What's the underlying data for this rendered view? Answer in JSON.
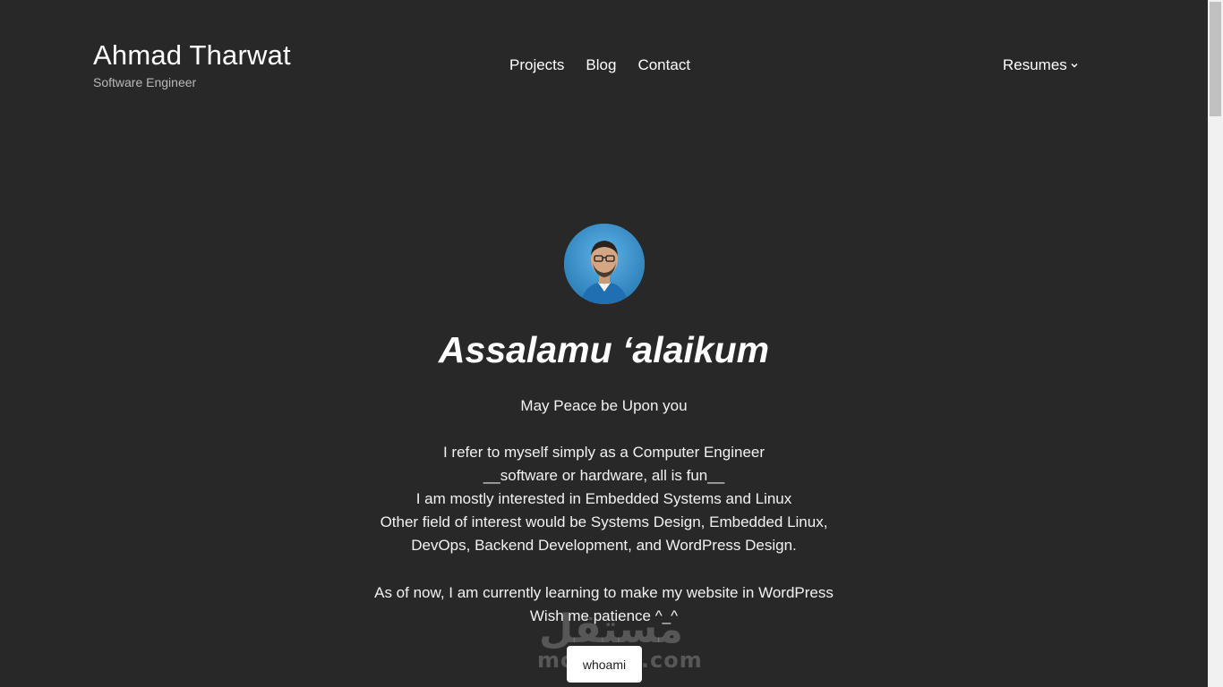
{
  "header": {
    "site_title": "Ahmad Tharwat",
    "tagline": "Software Engineer",
    "nav": [
      {
        "label": "Projects"
      },
      {
        "label": "Blog"
      },
      {
        "label": "Contact"
      }
    ],
    "resumes_label": "Resumes",
    "resumes_icon": "chevron-down-icon"
  },
  "hero": {
    "avatar_alt": "profile-photo",
    "greeting": "Assalamu ‘alaikum",
    "peace": "May Peace be Upon you",
    "bio_lines": [
      "I refer to myself simply as a Computer Engineer",
      "__software or hardware, all is fun__",
      "I am mostly interested in Embedded Systems and Linux",
      "Other field of interest would be Systems Design, Embedded Linux,",
      "DevOps, Backend Development, and WordPress Design."
    ],
    "learning_lines": [
      "As of now, I am currently learning to make my website in WordPress",
      "Wish me patience ^_^"
    ],
    "button_label": "whoami"
  },
  "watermark": {
    "arabic": "مستقل",
    "latin": "mostaql.com"
  },
  "colors": {
    "background": "#282828",
    "text": "#f2f2f2",
    "button_bg": "#ffffff",
    "avatar_bg": "#3a93cc"
  }
}
